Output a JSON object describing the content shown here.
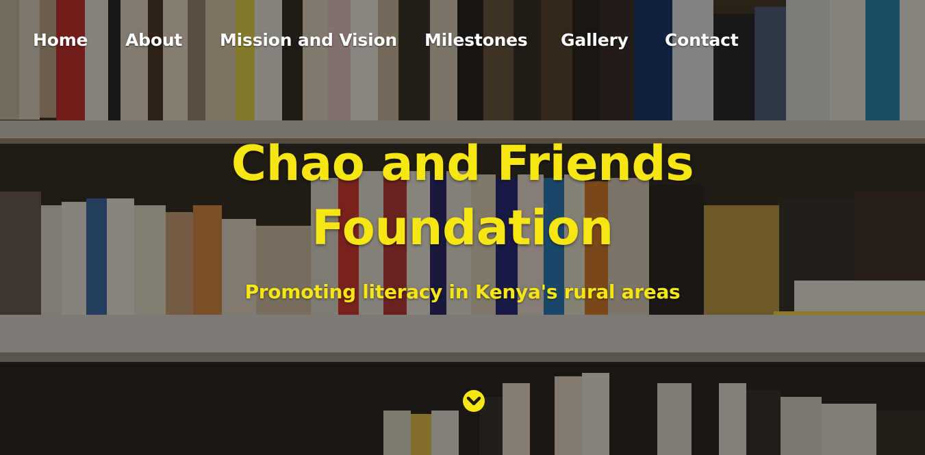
{
  "nav": {
    "items": [
      {
        "label": "Home"
      },
      {
        "label": "About"
      },
      {
        "label": "Mission and Vision"
      },
      {
        "label": "Milestones"
      },
      {
        "label": "Gallery"
      },
      {
        "label": "Contact"
      }
    ]
  },
  "hero": {
    "title_line1": "Chao and Friends",
    "title_line2": "Foundation",
    "subtitle": "Promoting literacy in Kenya's rural areas",
    "scroll_icon": "chevron-down-circle-icon",
    "background": "bookshelf-photo"
  },
  "colors": {
    "accent": "#f5e614",
    "nav_text": "#ffffff"
  }
}
